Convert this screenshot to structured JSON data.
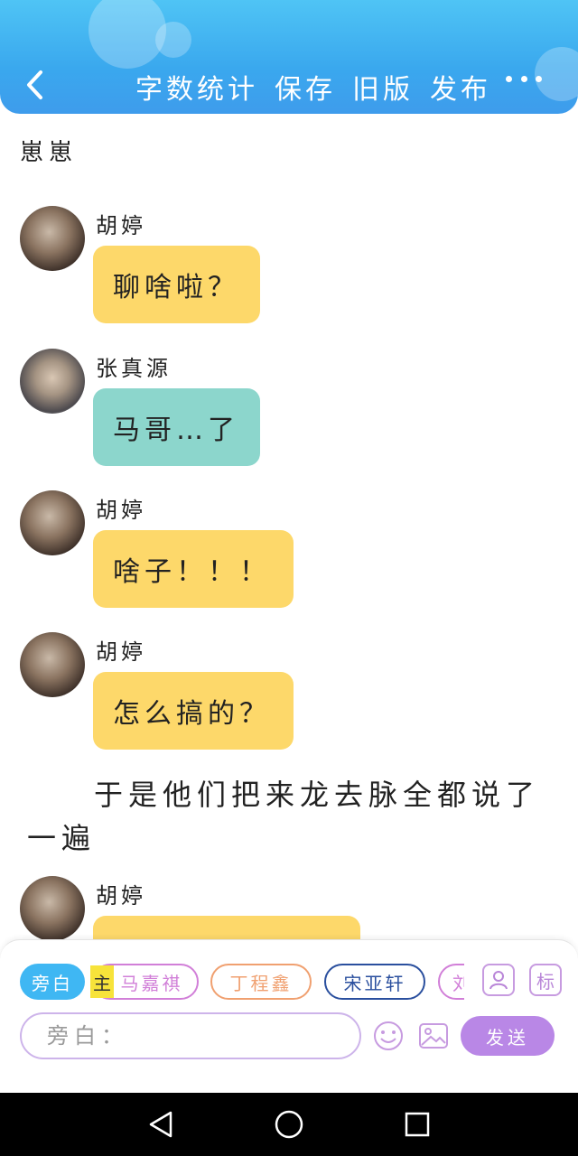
{
  "header": {
    "actions": [
      "字数统计",
      "保存",
      "旧版",
      "发布"
    ],
    "colors": {
      "gradient_top": "#4fc4f5",
      "gradient_bottom": "#3e9cec"
    }
  },
  "document": {
    "title": "崽崽"
  },
  "messages": [
    {
      "sender": "胡婷",
      "avatar": "hu-ting-avatar",
      "text": "聊啥啦？",
      "bubble_color": "#fdd86a"
    },
    {
      "sender": "张真源",
      "avatar": "zhang-zhenyuan-avatar",
      "text": "马哥…了",
      "bubble_color": "#8cd6cc"
    },
    {
      "sender": "胡婷",
      "avatar": "hu-ting-avatar",
      "text": "啥子！！！",
      "bubble_color": "#fdd86a"
    },
    {
      "sender": "胡婷",
      "avatar": "hu-ting-avatar",
      "text": "怎么搞的？",
      "bubble_color": "#fdd86a"
    }
  ],
  "narration": "于是他们把来龙去脉全都说了一遍",
  "last_message": {
    "sender": "胡婷",
    "text": "",
    "bubble_color": "#fdd86a"
  },
  "composer": {
    "roles": [
      {
        "label": "旁白",
        "color": "#3fb7f3",
        "active": true
      },
      {
        "label": "马嘉祺",
        "color": "#d17fd8"
      },
      {
        "label": "丁程鑫",
        "color": "#f0a070"
      },
      {
        "label": "宋亚轩",
        "color": "#2a4f9e"
      },
      {
        "label": "刘",
        "color": "#d17fd8"
      }
    ],
    "main_tag": "主",
    "input_placeholder": "旁白：",
    "send_label": "发送",
    "mark_label": "标",
    "accent": "#b987e6"
  }
}
